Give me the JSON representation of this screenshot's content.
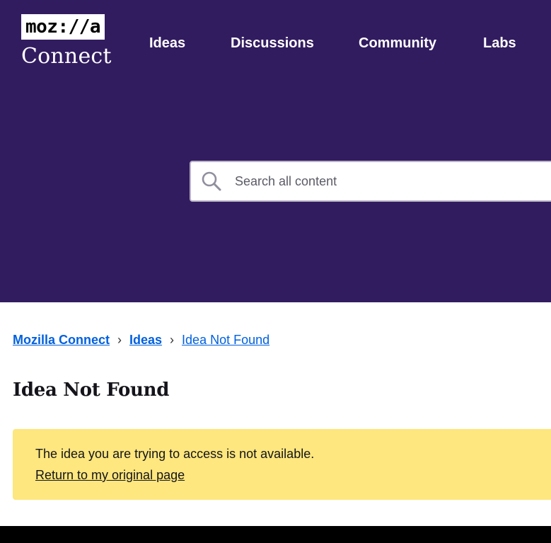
{
  "header": {
    "logo_wordmark": "moz://a",
    "logo_sub": "Connect",
    "nav": [
      {
        "label": "Ideas"
      },
      {
        "label": "Discussions"
      },
      {
        "label": "Community"
      },
      {
        "label": "Labs"
      }
    ]
  },
  "search": {
    "placeholder": "Search all content",
    "icon": "search-icon"
  },
  "breadcrumb": {
    "items": [
      {
        "label": "Mozilla Connect"
      },
      {
        "label": "Ideas"
      },
      {
        "label": "Idea Not Found"
      }
    ],
    "separator": "›"
  },
  "page": {
    "title": "Idea Not Found"
  },
  "alert": {
    "message": "The idea you are trying to access is not available.",
    "link": "Return to my original page"
  },
  "colors": {
    "hero": "#321c60",
    "link": "#0060df",
    "alert_bg": "#fde77e",
    "footer": "#000000"
  }
}
